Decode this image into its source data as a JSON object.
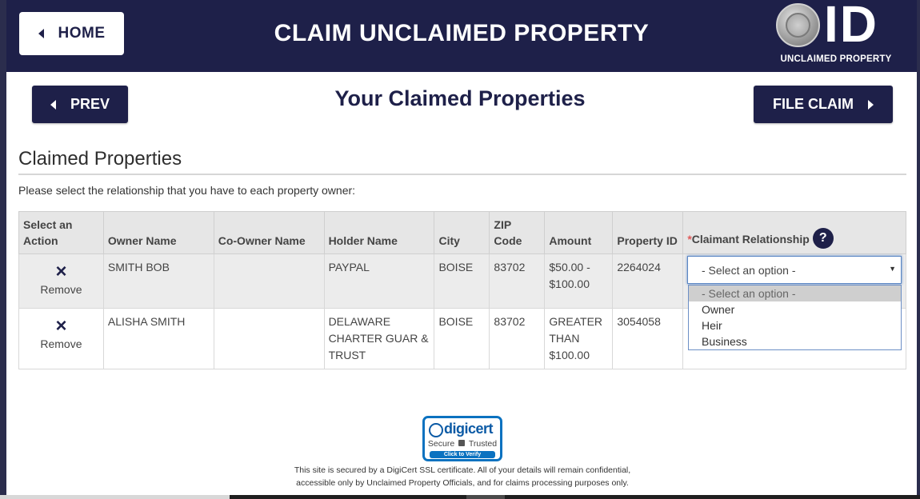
{
  "header": {
    "home_label": "HOME",
    "title": "CLAIM UNCLAIMED PROPERTY",
    "logo_id": "ID",
    "logo_sub": "UNCLAIMED PROPERTY"
  },
  "nav": {
    "prev_label": "PREV",
    "page_title": "Your Claimed Properties",
    "file_claim_label": "FILE CLAIM"
  },
  "section": {
    "title": "Claimed Properties",
    "instructions": "Please select the relationship that you have to each property owner:"
  },
  "table": {
    "headers": {
      "action": "Select an Action",
      "owner": "Owner Name",
      "coowner": "Co-Owner Name",
      "holder": "Holder Name",
      "city": "City",
      "zip": "ZIP Code",
      "amount": "Amount",
      "property_id": "Property ID",
      "relationship_required": "*",
      "relationship": "Claimant Relationship",
      "help": "?"
    },
    "rows": [
      {
        "remove_icon": "×",
        "remove_label": "Remove",
        "owner": "SMITH BOB",
        "coowner": "",
        "holder": "PAYPAL",
        "city": "BOISE",
        "zip": "83702",
        "amount": "$50.00 - $100.00",
        "property_id": "2264024"
      },
      {
        "remove_icon": "×",
        "remove_label": "Remove",
        "owner": "ALISHA SMITH",
        "coowner": "",
        "holder": "DELAWARE CHARTER GUAR & TRUST",
        "city": "BOISE",
        "zip": "83702",
        "amount": "GREATER THAN $100.00",
        "property_id": "3054058"
      }
    ]
  },
  "relationship_select": {
    "value": "- Select an option -",
    "options": [
      "- Select an option -",
      "Owner",
      "Heir",
      "Business"
    ]
  },
  "footer": {
    "badge_brand": "digicert",
    "badge_secure": "Secure",
    "badge_trusted": "Trusted",
    "badge_verify": "Click to Verify",
    "ssl_line1": "This site is secured by a DigiCert SSL certificate. All of your details will remain confidential,",
    "ssl_line2": "accessible only by Unclaimed Property Officials, and for claims processing purposes only."
  },
  "colors": {
    "navy": "#1e2049",
    "required": "#e05a5a",
    "digicert_blue": "#0b72c0"
  }
}
